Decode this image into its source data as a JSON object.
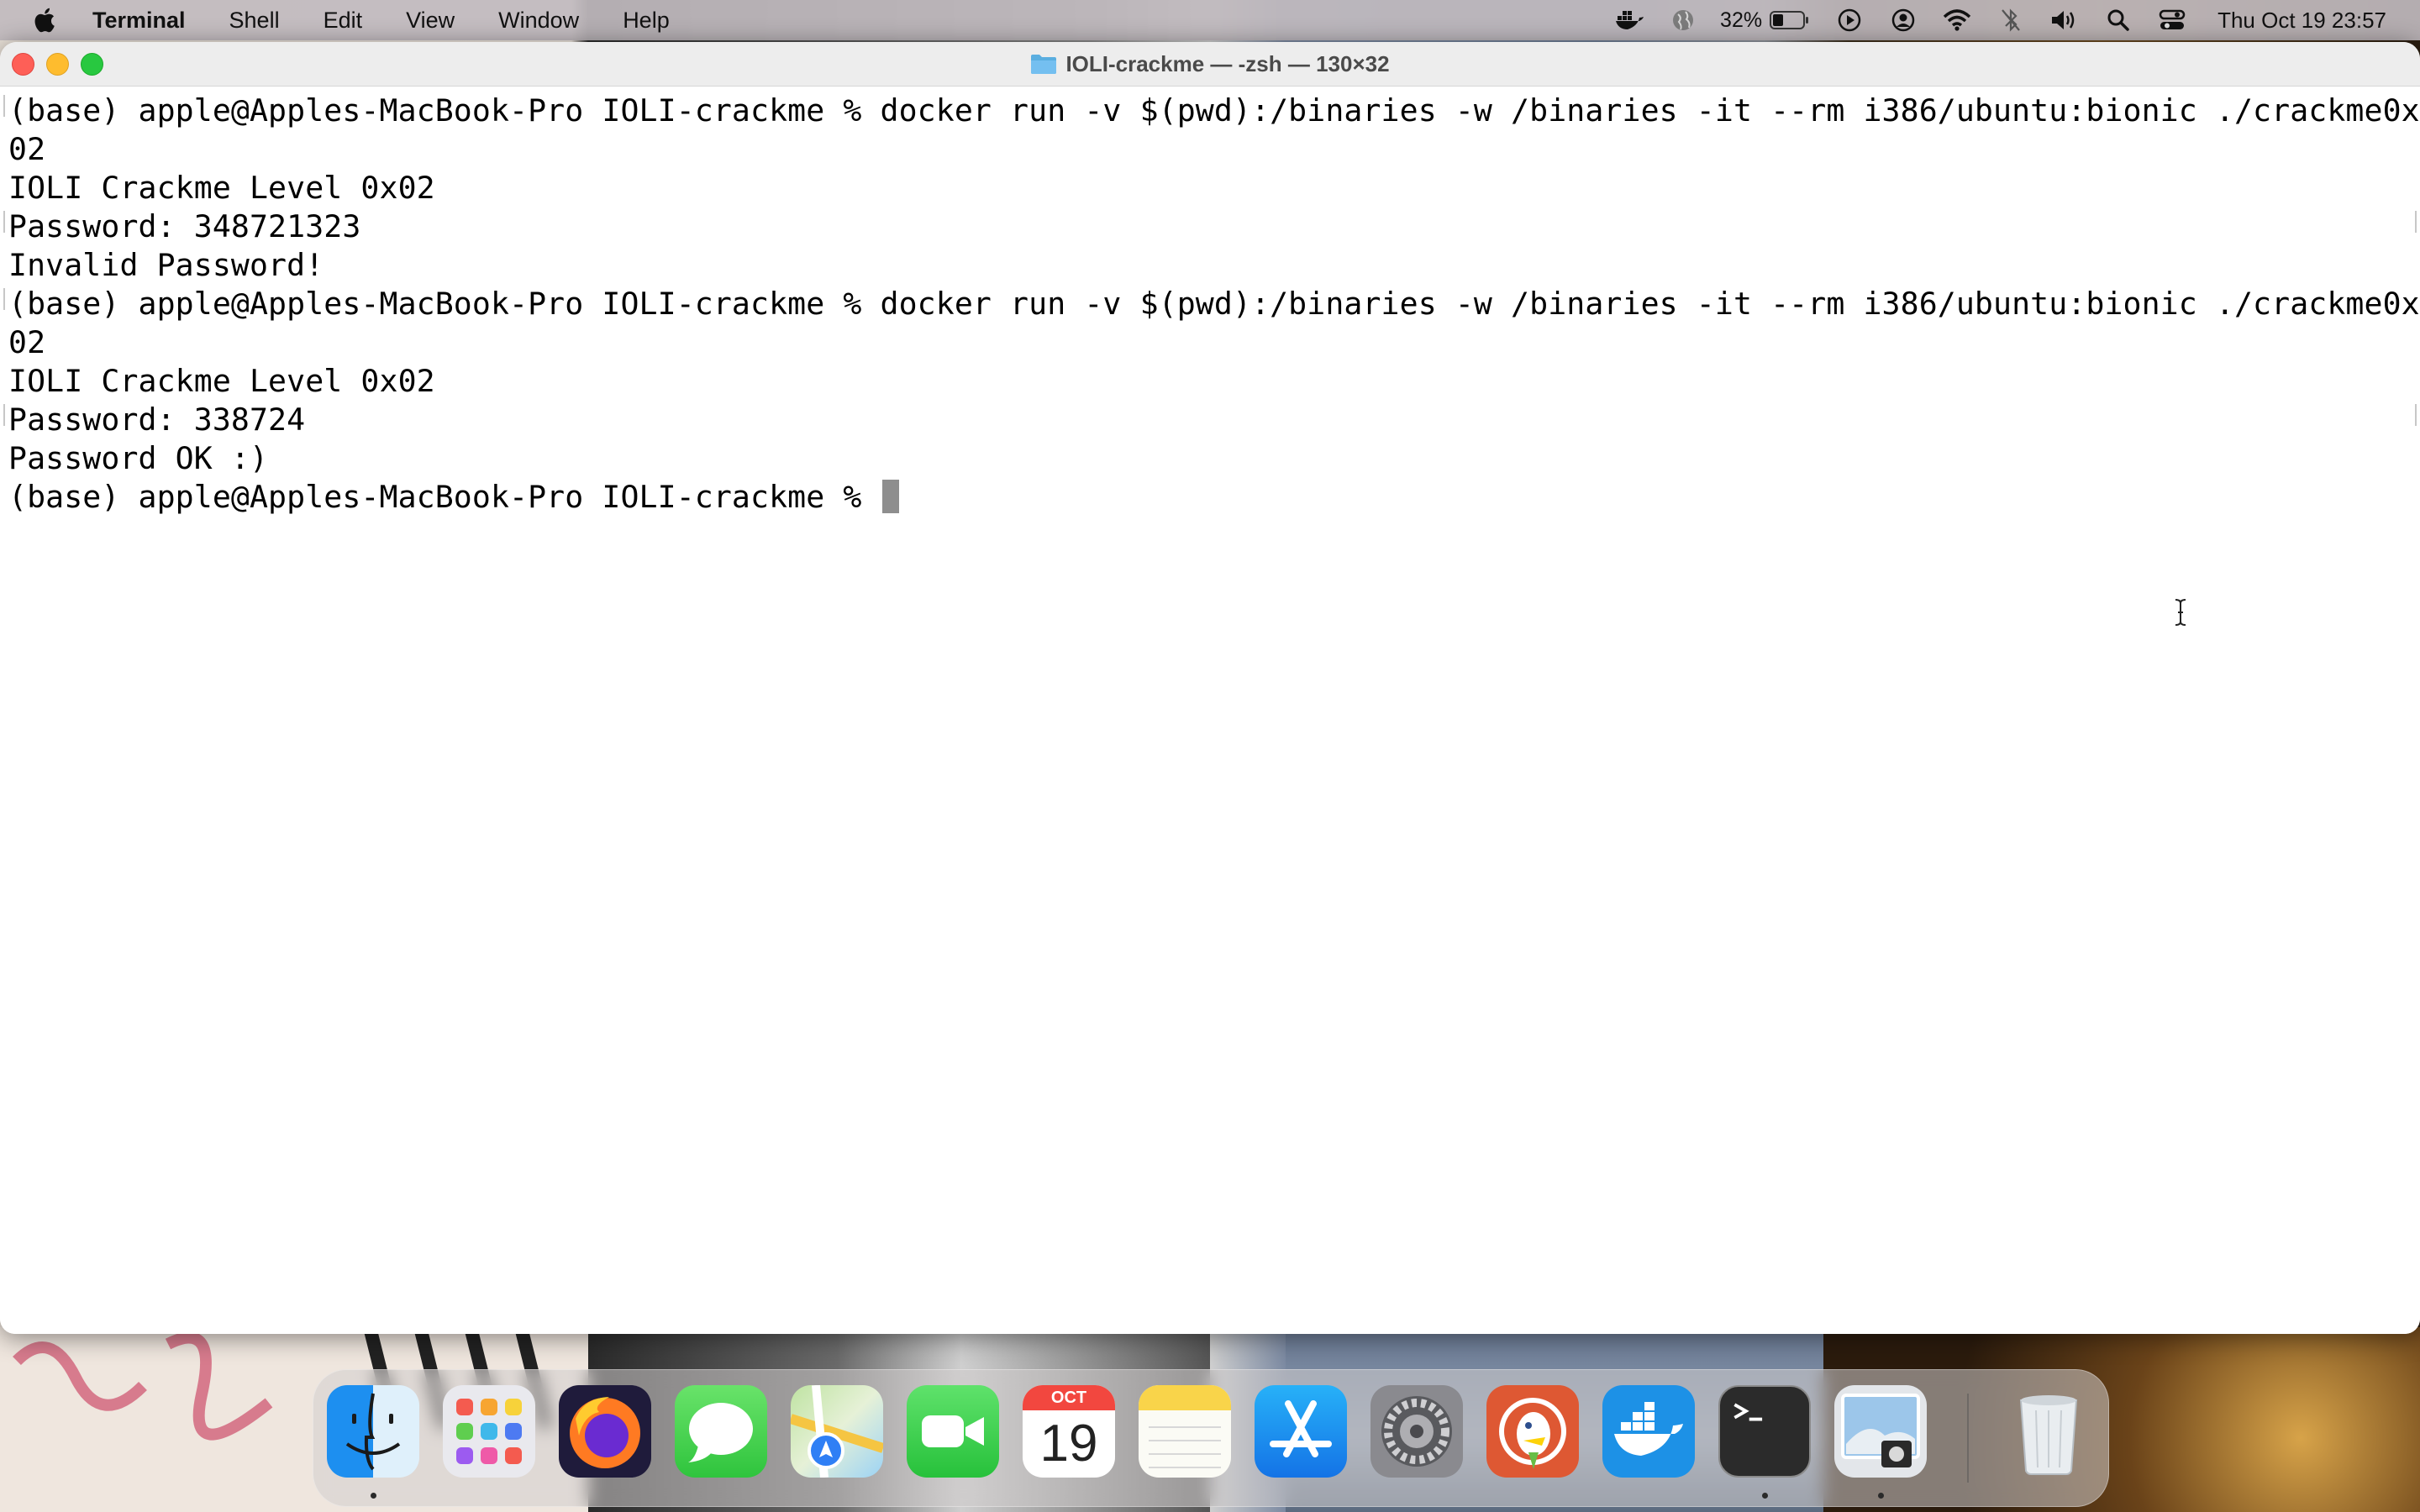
{
  "menubar": {
    "app_name": "Terminal",
    "menus": [
      "Shell",
      "Edit",
      "View",
      "Window",
      "Help"
    ],
    "battery_percent": "32%",
    "clock": "Thu Oct 19  23:57",
    "status_icons": [
      "docker-icon",
      "globe-icon",
      "battery-icon",
      "play-icon",
      "user-icon",
      "wifi-icon",
      "bluetooth-off-icon",
      "volume-icon",
      "search-icon",
      "control-center-icon"
    ]
  },
  "window": {
    "title": "IOLI-crackme — -zsh — 130×32"
  },
  "terminal": {
    "lines": [
      "(base) apple@Apples-MacBook-Pro IOLI-crackme % docker run -v $(pwd):/binaries -w /binaries -it --rm i386/ubuntu:bionic ./crackme0x",
      "02",
      "IOLI Crackme Level 0x02",
      "Password: 348721323",
      "Invalid Password!",
      "(base) apple@Apples-MacBook-Pro IOLI-crackme % docker run -v $(pwd):/binaries -w /binaries -it --rm i386/ubuntu:bionic ./crackme0x",
      "02",
      "IOLI Crackme Level 0x02",
      "Password: 338724",
      "Password OK :)",
      "(base) apple@Apples-MacBook-Pro IOLI-crackme % "
    ]
  },
  "dock": {
    "apps": [
      "Finder",
      "Launchpad",
      "Firefox",
      "Messages",
      "Maps",
      "FaceTime",
      "Calendar",
      "Notes",
      "App Store",
      "System Preferences",
      "DuckDuckGo",
      "Docker",
      "Terminal",
      "Preview",
      "Trash"
    ],
    "calendar_month": "OCT",
    "calendar_day": "19"
  },
  "colors": {
    "close": "#fe5f57",
    "minimize": "#febc2e",
    "maximize": "#28c840",
    "cursor": "#8e8e8e"
  }
}
